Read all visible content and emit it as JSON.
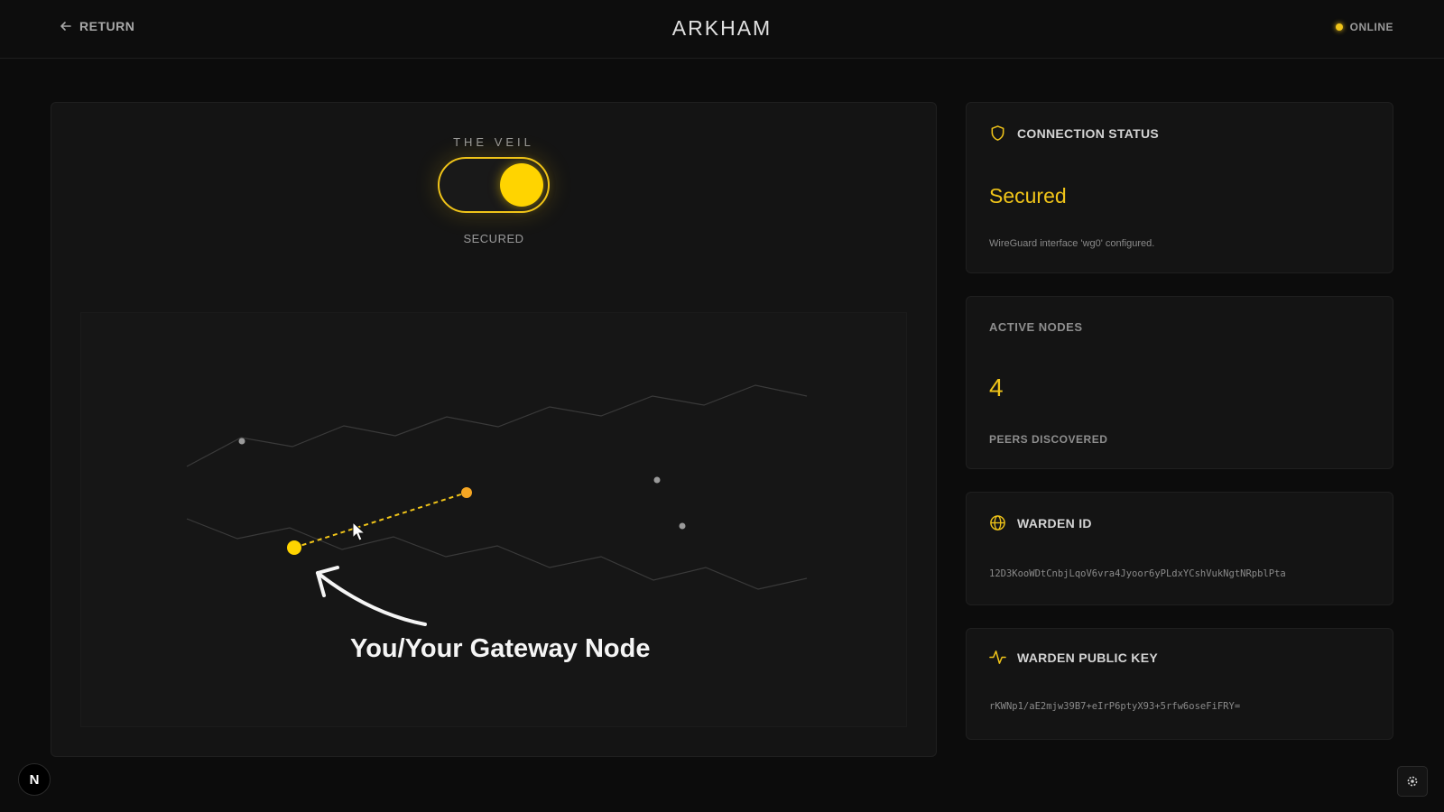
{
  "header": {
    "return_label": "RETURN",
    "title": "ARKHAM",
    "status_label": "ONLINE"
  },
  "veil": {
    "label": "THE VEIL",
    "toggle_on": true,
    "state_label": "SECURED"
  },
  "network": {
    "callout": "You/Your Gateway Node"
  },
  "cards": {
    "connection": {
      "title": "CONNECTION STATUS",
      "value": "Secured",
      "note": "WireGuard interface 'wg0' configured."
    },
    "nodes": {
      "title": "ACTIVE NODES",
      "count": "4",
      "subtitle": "PEERS DISCOVERED"
    },
    "warden_id": {
      "title": "WARDEN ID",
      "value": "12D3KooWDtCnbjLqoV6vra4Jyoor6yPLdxYCshVukNgtNRpblPta"
    },
    "warden_key": {
      "title": "WARDEN PUBLIC KEY",
      "value": "rKWNp1/aE2mjw39B7+eIrP6ptyX93+5rfw6oseFiFRY="
    }
  },
  "footer": {
    "badge_letter": "N"
  },
  "icons": {
    "return": "arrow-left-icon",
    "connection": "shield-icon",
    "warden_id": "globe-icon",
    "warden_key": "activity-icon",
    "settings": "gear-icon"
  },
  "colors": {
    "accent": "#f0c419",
    "knob": "#ffd400",
    "peer_node": "#f5a623",
    "background": "#0c0c0c",
    "panel": "#141414"
  }
}
